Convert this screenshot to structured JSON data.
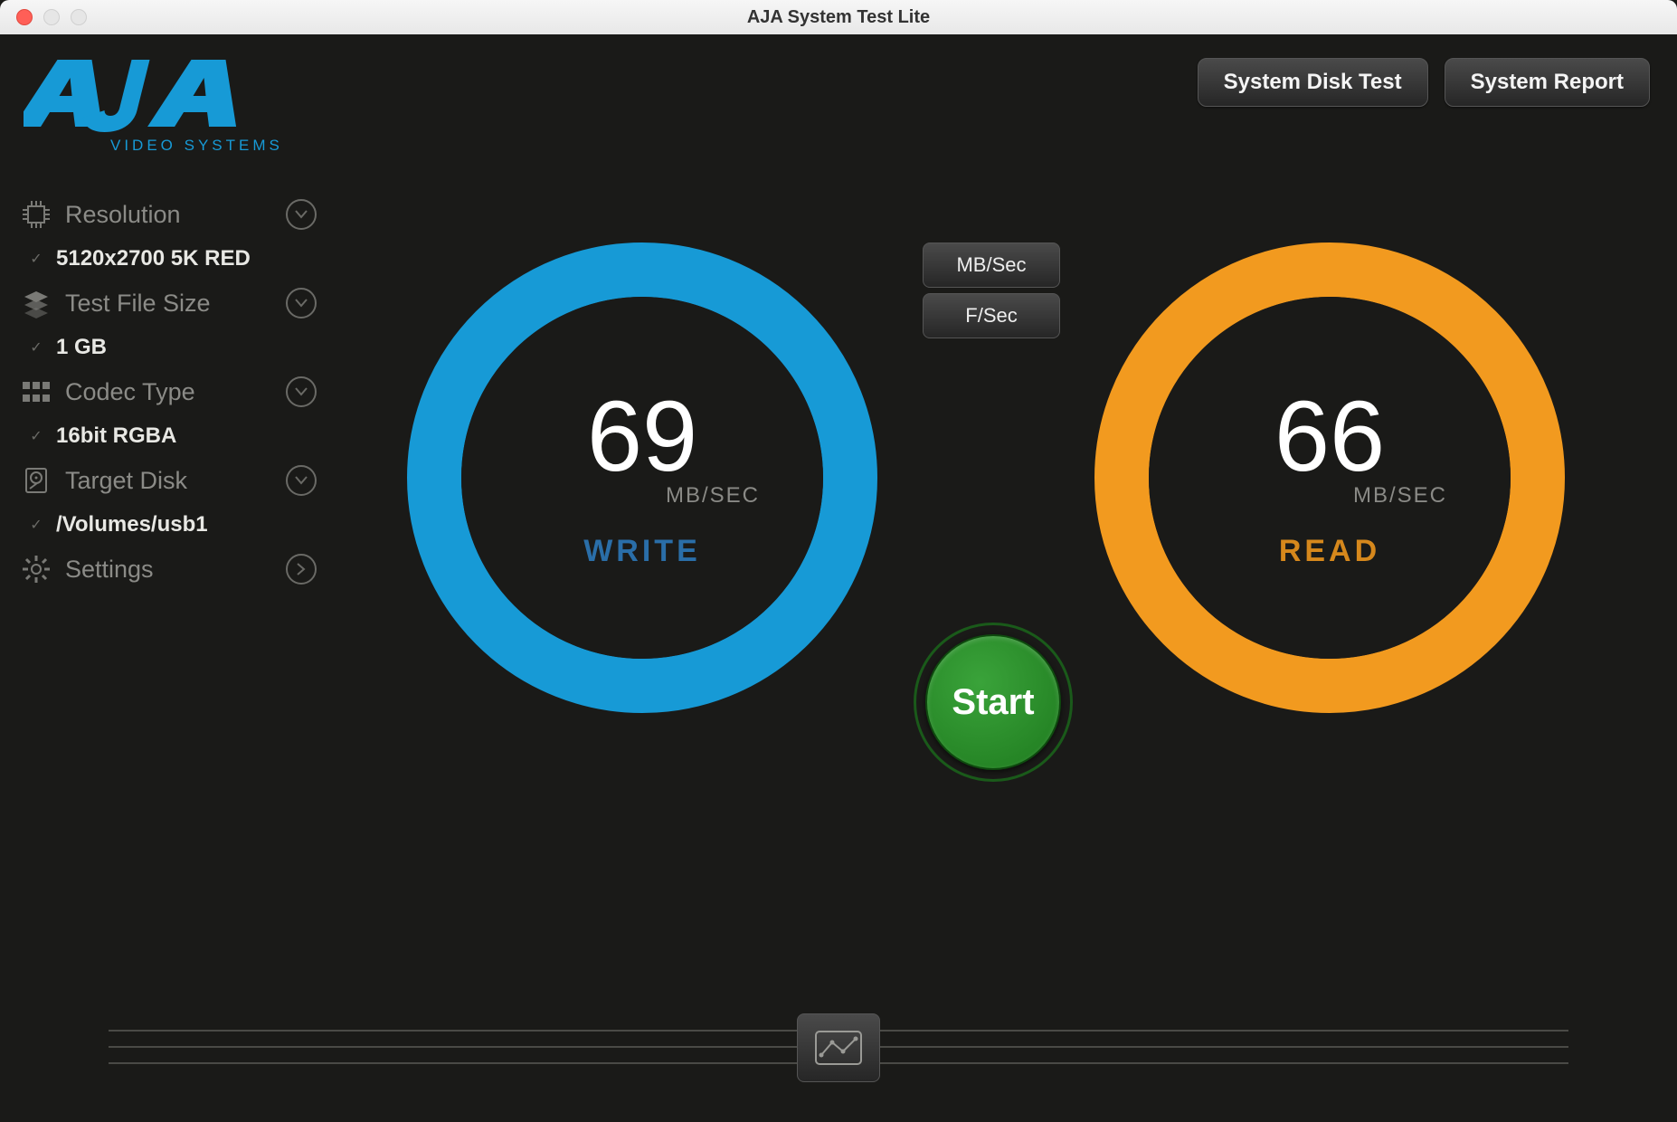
{
  "window": {
    "title": "AJA System Test Lite"
  },
  "logo": {
    "brand": "AJA",
    "tagline": "VIDEO SYSTEMS"
  },
  "topbar": {
    "disk_test_label": "System Disk Test",
    "report_label": "System Report"
  },
  "sidebar": {
    "resolution": {
      "label": "Resolution",
      "value": "5120x2700 5K RED"
    },
    "filesize": {
      "label": "Test File Size",
      "value": "1 GB"
    },
    "codec": {
      "label": "Codec Type",
      "value": "16bit RGBA"
    },
    "disk": {
      "label": "Target Disk",
      "value": "/Volumes/usb1"
    },
    "settings": {
      "label": "Settings"
    }
  },
  "units": {
    "mbsec": "MB/Sec",
    "fsec": "F/Sec"
  },
  "gauge": {
    "write": {
      "value": "69",
      "unit": "MB/SEC",
      "label": "WRITE"
    },
    "read": {
      "value": "66",
      "unit": "MB/SEC",
      "label": "READ"
    }
  },
  "start": {
    "label": "Start"
  },
  "colors": {
    "write": "#179ad6",
    "read": "#f29a1f",
    "start": "#2a8a2a"
  }
}
